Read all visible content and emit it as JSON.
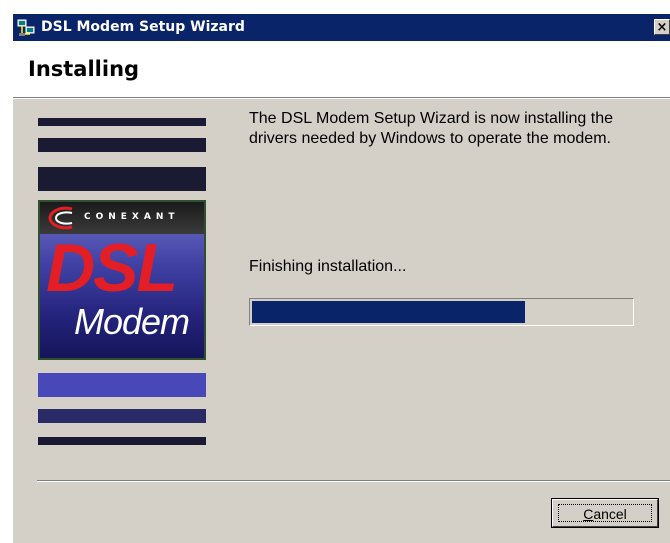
{
  "window": {
    "title": "DSL Modem Setup Wizard",
    "close_glyph": "×"
  },
  "header": {
    "title": "Installing"
  },
  "main": {
    "description": "The DSL Modem Setup Wizard is now installing the drivers needed by Windows to operate the modem.",
    "status": "Finishing installation...",
    "progress_fraction": 0.72
  },
  "logo": {
    "brand": "CONEXANT",
    "product_big": "DSL",
    "product_sub": "Modem"
  },
  "buttons": {
    "cancel_accel": "C",
    "cancel_rest": "ancel"
  },
  "colors": {
    "title_bar": "#0a246a",
    "progress_fill": "#0a246a",
    "dialog_face": "#d4d0c8",
    "logo_red": "#e31e24"
  },
  "icons": {
    "title_icon": "network-computers-icon",
    "logo_swoosh": "conexant-swoosh-icon"
  }
}
